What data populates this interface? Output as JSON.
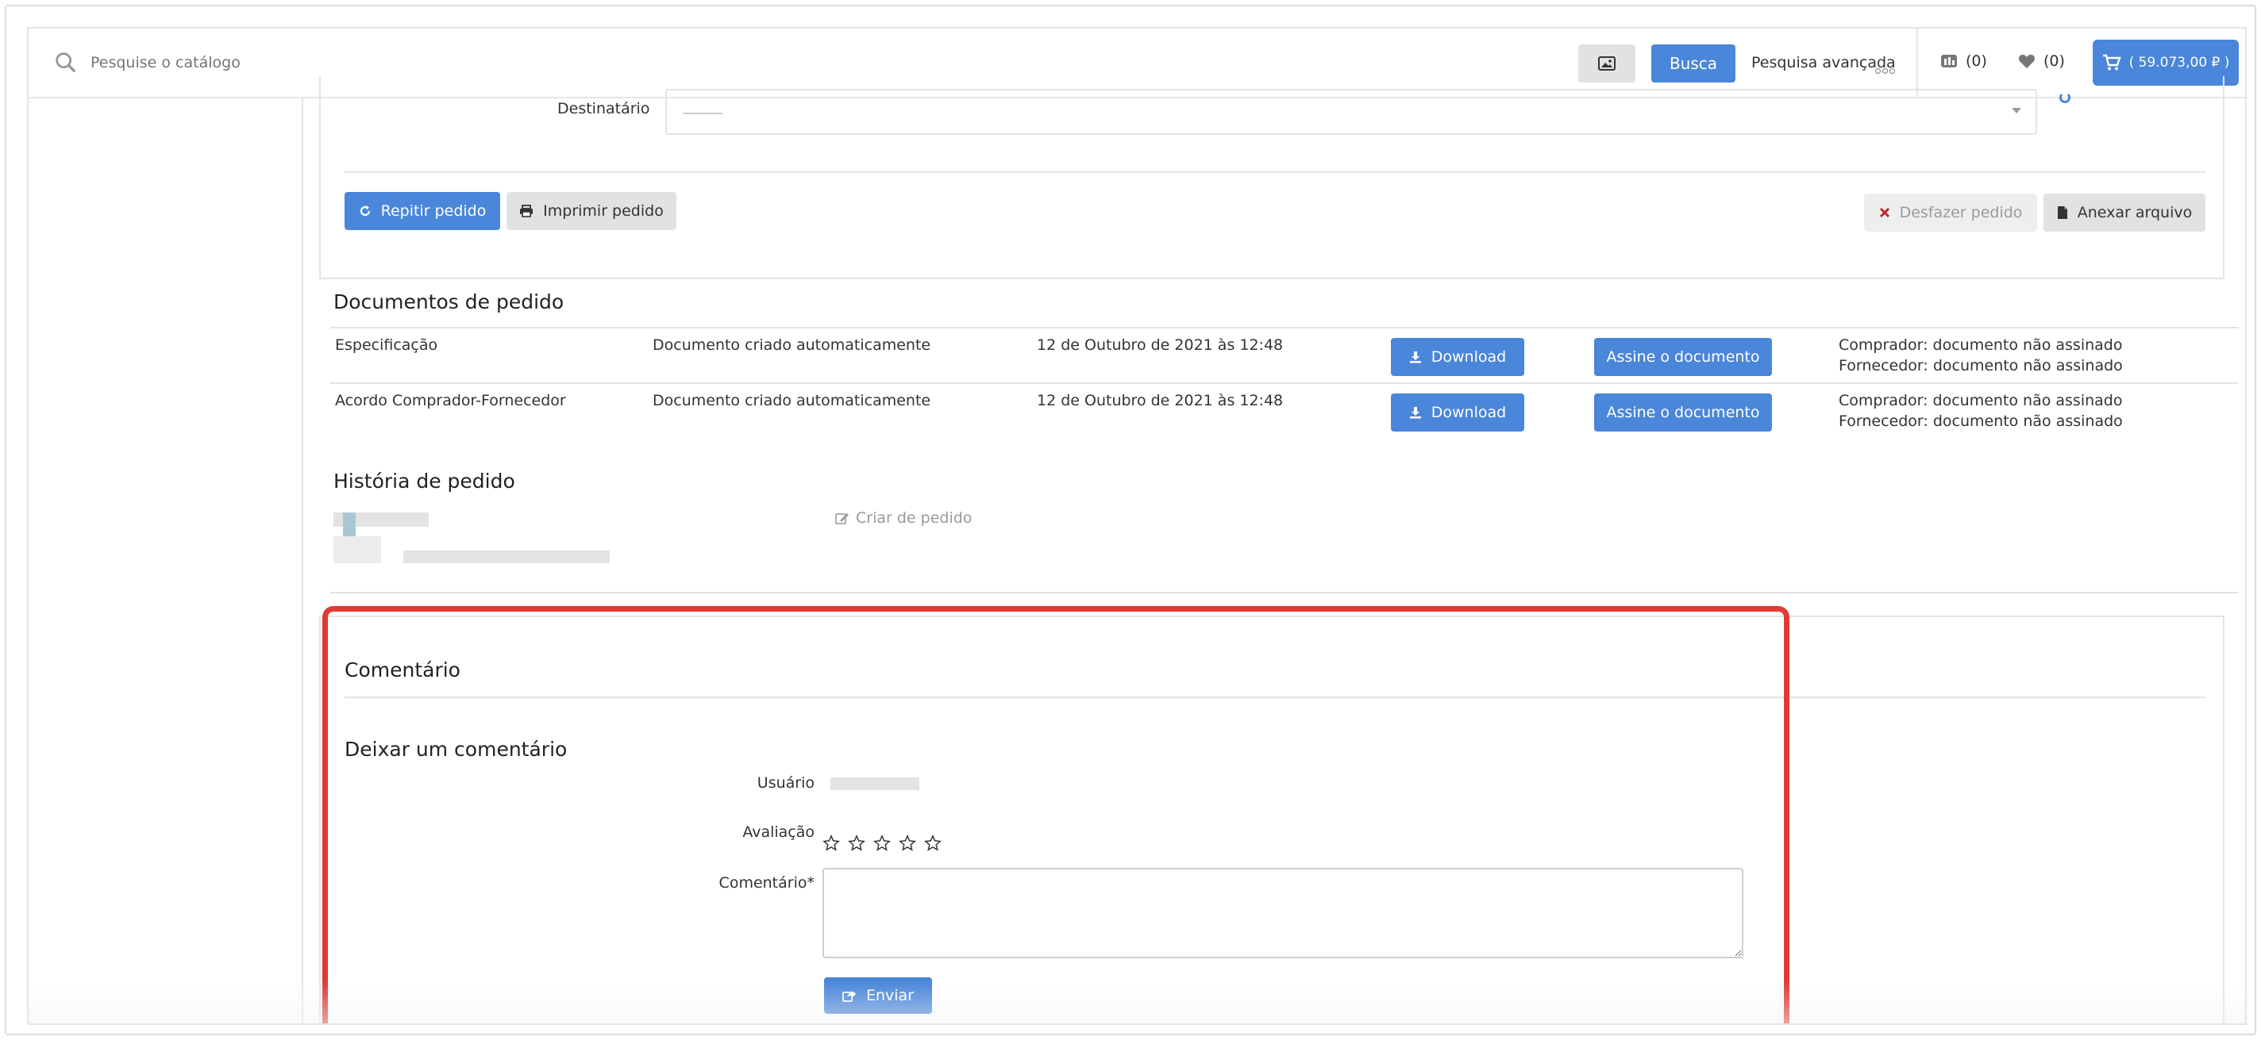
{
  "search": {
    "placeholder": "Pesquise o catálogo"
  },
  "toolbar": {
    "search_button": "Busca",
    "advanced_search": "Pesquisa avançada",
    "compare_count": "(0)",
    "wishlist_count": "(0)",
    "cart_total": "( 59.073,00 ₽ )"
  },
  "order": {
    "recipient_label": "Destinatário",
    "repeat_button": "Repitir pedido",
    "print_button": "Imprimir pedido",
    "cancel_button": "Desfazer pedido",
    "attach_button": "Anexar arquivo"
  },
  "documents": {
    "title": "Documentos de pedido",
    "download_label": "Download",
    "sign_label": "Assine o documento",
    "rows": [
      {
        "name": "Especificação",
        "origin": "Documento criado automaticamente",
        "date": "12 de Outubro de 2021 às 12:48",
        "status_buyer": "Comprador: documento não assinado",
        "status_supplier": "Fornecedor: documento não assinado"
      },
      {
        "name": "Acordo Comprador-Fornecedor",
        "origin": "Documento criado automaticamente",
        "date": "12 de Outubro de 2021 às 12:48",
        "status_buyer": "Comprador: documento não assinado",
        "status_supplier": "Fornecedor: documento não assinado"
      }
    ]
  },
  "history": {
    "title": "História de pedido",
    "create_label": "Criar de pedido"
  },
  "comment": {
    "title": "Comentário",
    "leave_title": "Deixar um comentário",
    "user_label": "Usuário",
    "rating_label": "Avaliação",
    "comment_label": "Comentário*",
    "rating_value": 0,
    "rating_max": 5,
    "send_button": "Enviar"
  },
  "colors": {
    "accent": "#4a86d9",
    "highlight": "#e03a33"
  }
}
